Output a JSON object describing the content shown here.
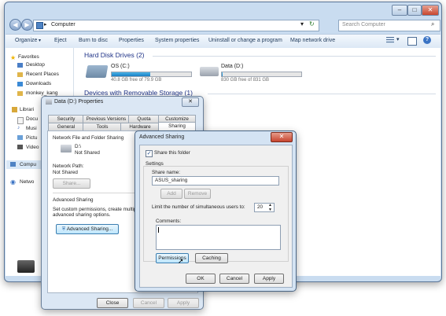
{
  "explorer": {
    "address": "Computer",
    "address_arrow": "▸",
    "search_placeholder": "Search Computer",
    "caption": {
      "min": "–",
      "max": "□",
      "close": "✕"
    },
    "toolbar": [
      "Organize",
      "Eject",
      "Burn to disc",
      "Properties",
      "System properties",
      "Uninstall or change a program",
      "Map network drive"
    ],
    "nav": {
      "favorites": "Favorites",
      "desktop": "Desktop",
      "recent": "Recent Places",
      "downloads": "Downloads",
      "user": "monkey_kang",
      "libraries": "Librari",
      "documents": "Docu",
      "music": "Musi",
      "pictures": "Pictu",
      "videos": "Video",
      "computer": "Compu",
      "network": "Netwo"
    },
    "groups": {
      "hdd": "Hard Disk Drives (2)",
      "removable": "Devices with Removable Storage (1)"
    },
    "drives": [
      {
        "name": "OS (C:)",
        "free": "40.8 GB free of 79.9 GB",
        "used_fraction": 0.49
      },
      {
        "name": "Data (D:)",
        "free": "830 GB free of 831 GB",
        "used_fraction": 0.002
      }
    ]
  },
  "props": {
    "title": "Data (D:) Properties",
    "tabs_row1": [
      "Security",
      "Previous Versions",
      "Quota",
      "Customize"
    ],
    "tabs_row2": [
      "General",
      "Tools",
      "Hardware",
      "Sharing"
    ],
    "section1": "Network File and Folder Sharing",
    "drive": "D:\\",
    "drive_status": "Not Shared",
    "network_path_label": "Network Path:",
    "network_path": "Not Shared",
    "share_btn": "Share...",
    "section2": "Advanced Sharing",
    "adv_desc1": "Set custom permissions, create multiple",
    "adv_desc2": "advanced sharing options.",
    "adv_btn": "Advanced Sharing...",
    "close": "Close",
    "cancel": "Cancel",
    "apply": "Apply"
  },
  "adv": {
    "title": "Advanced Sharing",
    "checkbox_label": "Share this folder",
    "checkbox_checked": true,
    "settings": "Settings",
    "share_name_label": "Share name:",
    "share_name": "ASUS_sharing",
    "add": "Add",
    "remove": "Remove",
    "limit_label": "Limit the number of simultaneous users to:",
    "limit_value": "20",
    "comments_label": "Comments:",
    "permissions": "Permissions",
    "caching": "Caching",
    "ok": "OK",
    "cancel": "Cancel",
    "apply": "Apply"
  },
  "colors": {
    "accent": "#1e3287",
    "drive_fill": "#1a7fc2",
    "close_red": "#c7452f"
  }
}
